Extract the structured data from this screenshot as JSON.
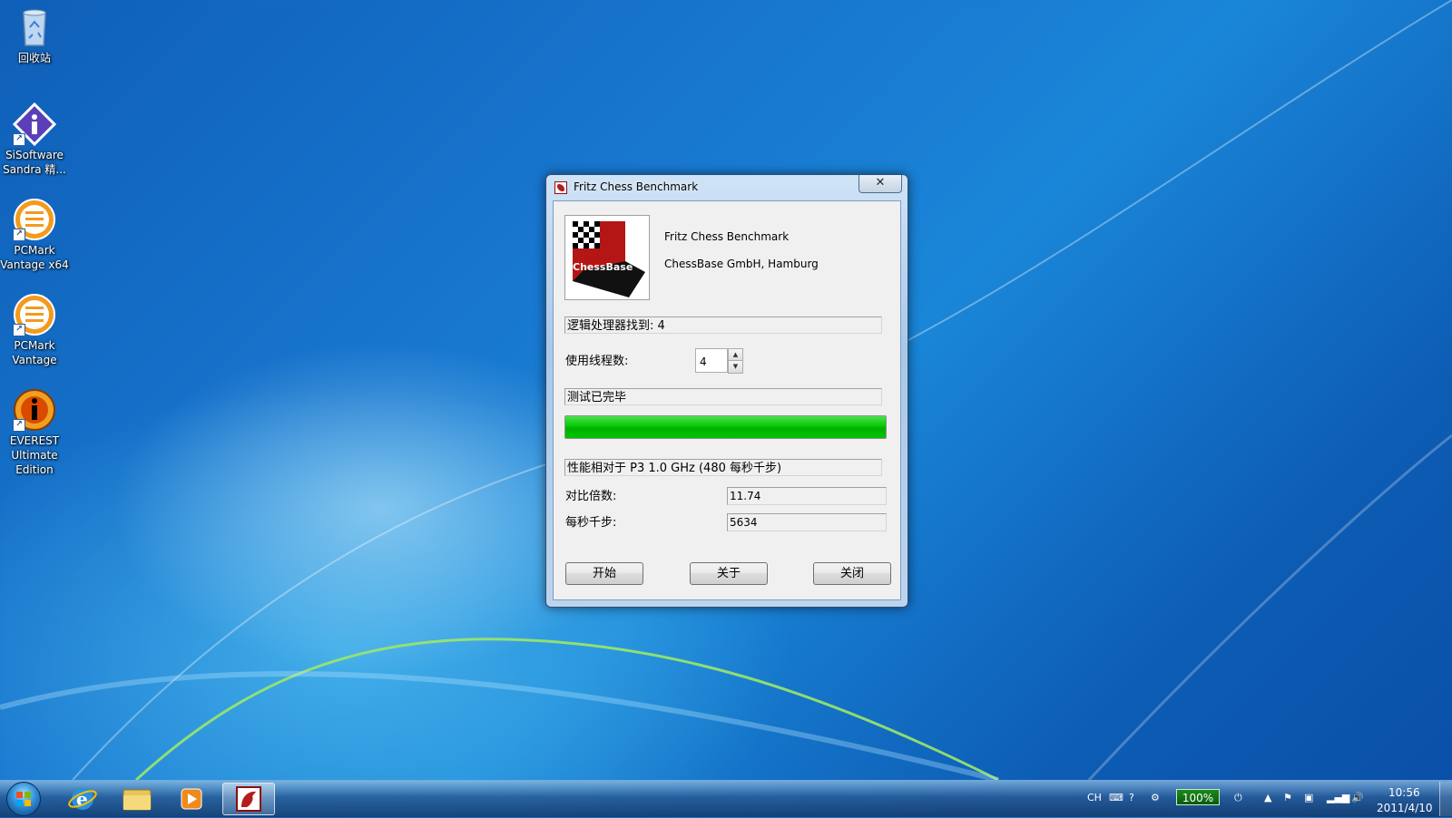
{
  "desktop": {
    "icons": [
      {
        "label": "回收站"
      },
      {
        "label": "SiSoftware\nSandra 精..."
      },
      {
        "label": "PCMark\nVantage x64"
      },
      {
        "label": "PCMark\nVantage"
      },
      {
        "label": "EVEREST\nUltimate\nEdition"
      }
    ]
  },
  "window": {
    "title": "Fritz Chess Benchmark",
    "close_glyph": "✕",
    "logo_text": "ChessBase",
    "about_name": "Fritz Chess Benchmark",
    "about_company": "ChessBase GmbH, Hamburg",
    "logical_processors": "逻辑处理器找到: 4",
    "threads_label": "使用线程数:",
    "threads_value": "4",
    "status": "测试已完毕",
    "progress": 1.0,
    "progress_color": "#06c806",
    "performance_relative": "性能相对于 P3 1.0 GHz (480 每秒千步)",
    "ratio_label": "对比倍数:",
    "ratio_value": "11.74",
    "kn_label": "每秒千步:",
    "kn_value": "5634",
    "buttons": {
      "start": "开始",
      "about": "关于",
      "close": "关闭"
    }
  },
  "taskbar": {
    "tray": {
      "lang": "CH",
      "battery": "100%",
      "time": "10:56",
      "date": "2011/4/10"
    }
  }
}
